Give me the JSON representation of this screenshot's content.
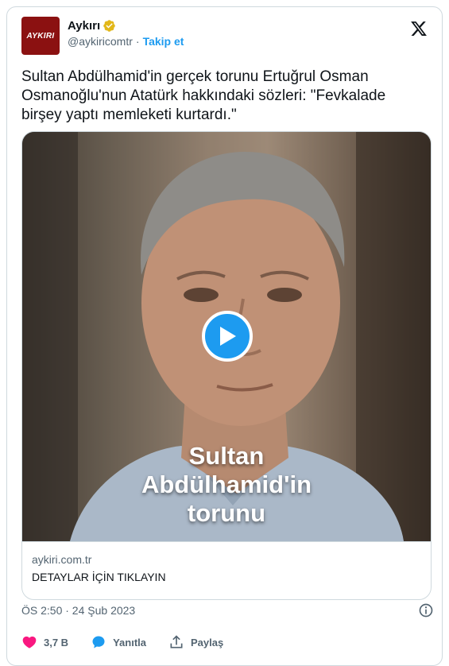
{
  "account": {
    "avatar_text": "AYKIRI",
    "name": "Aykırı",
    "handle": "@aykiricomtr",
    "separator": "·",
    "follow_label": "Takip et"
  },
  "tweet": {
    "text": "Sultan Abdülhamid'in gerçek torunu Ertuğrul Osman\nOsmanoğlu'nun Atatürk hakkındaki sözleri: \"Fevkalade\nbirşey yaptı memleketi kurtardı.\""
  },
  "media": {
    "caption": "Sultan\nAbdülhamid'in\ntorunu",
    "link_domain": "aykiri.com.tr",
    "link_title": "DETAYLAR İÇİN TIKLAYIN"
  },
  "meta": {
    "timestamp": "ÖS 2:50 · 24 Şub 2023"
  },
  "actions": {
    "likes": "3,7 B",
    "reply_label": "Yanıtla",
    "share_label": "Paylaş"
  },
  "colors": {
    "accent": "#1d9bf0",
    "like": "#f91880",
    "verified_gold": "#e2b719",
    "avatar_bg": "#8b1111"
  },
  "icons": [
    "verified-badge-icon",
    "x-logo-icon",
    "play-icon",
    "info-icon",
    "heart-icon",
    "reply-icon",
    "share-icon"
  ]
}
